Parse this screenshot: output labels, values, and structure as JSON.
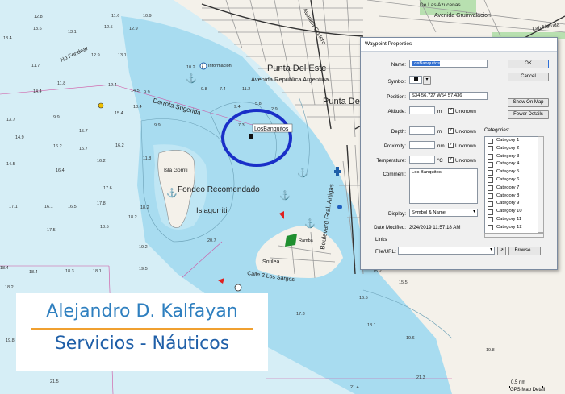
{
  "map": {
    "streets": [
      "Avenida República Argentina",
      "Avenida Gorlero",
      "Avenida Gruinvalacion",
      "De Las Azucenas",
      "Lab Neruda"
    ],
    "places": [
      "Punta Del Este",
      "Punta Del E",
      "Sotilea",
      "Calle 2 Los Sargos"
    ],
    "features": [
      "Isla Gorriti",
      "Fondeo Recomendado",
      "Islagorriti",
      "Derrota Sugerida",
      "No Fondear",
      "Informacion",
      "Ramba"
    ],
    "road_sign": "Boulevard Gral. Artigas",
    "waypoint_label": "LosBanquitos",
    "soundings": [
      "12.8",
      "12.5",
      "13.6",
      "13.1",
      "11.6",
      "12.9",
      "13.4",
      "12.9",
      "13.1",
      "11.7",
      "10.9",
      "10.2",
      "14.4",
      "11.8",
      "12.4",
      "14.5",
      "9.9",
      "9.8",
      "13.4",
      "9.9",
      "7.4",
      "11.2",
      "9.4",
      "5.8",
      "2.9",
      "13.7",
      "9.9",
      "15.4",
      "15.7",
      "7.3",
      "14.9",
      "16.2",
      "16.2",
      "14.5",
      "16.2",
      "11.8",
      "15.7",
      "16.4",
      "17.6",
      "17.1",
      "16.1",
      "16.5",
      "17.8",
      "18.2",
      "17.5",
      "18.5",
      "18.2",
      "19.2",
      "18.4",
      "18.3",
      "18.1",
      "18.4",
      "19.5",
      "18.2",
      "20.7",
      "21.5",
      "15.2",
      "15.5",
      "16.5",
      "17.3",
      "18.1",
      "19.6",
      "19.8",
      "21.3",
      "21.4",
      "19.8"
    ]
  },
  "dialog": {
    "title": "Waypoint Properties",
    "name_label": "Name:",
    "name_value": "LosBanquitos",
    "symbol_label": "Symbol:",
    "position_label": "Position:",
    "position_value": "S34 56.727 W54 57.436",
    "altitude_label": "Altitude:",
    "depth_label": "Depth:",
    "proximity_label": "Proximity:",
    "temperature_label": "Temperature:",
    "unit_m": "m",
    "unit_nm": "nm",
    "unit_c": "ºC",
    "unknown_label": "Unknown",
    "comment_label": "Comment:",
    "comment_value": "Los Banquitos",
    "display_label": "Display:",
    "display_value": "Symbol & Name",
    "date_label": "Date Modified:",
    "date_value": "2/24/2019 11:57:18 AM",
    "links_label": "Links",
    "fileurl_label": "File/URL:",
    "ok_label": "OK",
    "cancel_label": "Cancel",
    "showonmap_label": "Show On Map",
    "fewerdetails_label": "Fewer Details",
    "browse_label": "Browse...",
    "categories_label": "Categories:",
    "categories": [
      "Category 1",
      "Category 2",
      "Category 3",
      "Category 4",
      "Category 5",
      "Category 6",
      "Category 7",
      "Category 8",
      "Category 9",
      "Category 10",
      "Category 11",
      "Category 12"
    ]
  },
  "logo": {
    "line1": "Alejandro D. Kalfayan",
    "line2": "Servicios - Náuticos"
  },
  "scale_label": "0.5 nm",
  "map_source": "GPS Map Detail",
  "colors": {
    "deep_water": "#d6eef6",
    "shallow_water": "#a8dcf0",
    "land": "#f4f1ea",
    "highlight_circle": "#1a2fc8",
    "logo_blue": "#2e7fbf",
    "logo_orange": "#f0a030"
  }
}
